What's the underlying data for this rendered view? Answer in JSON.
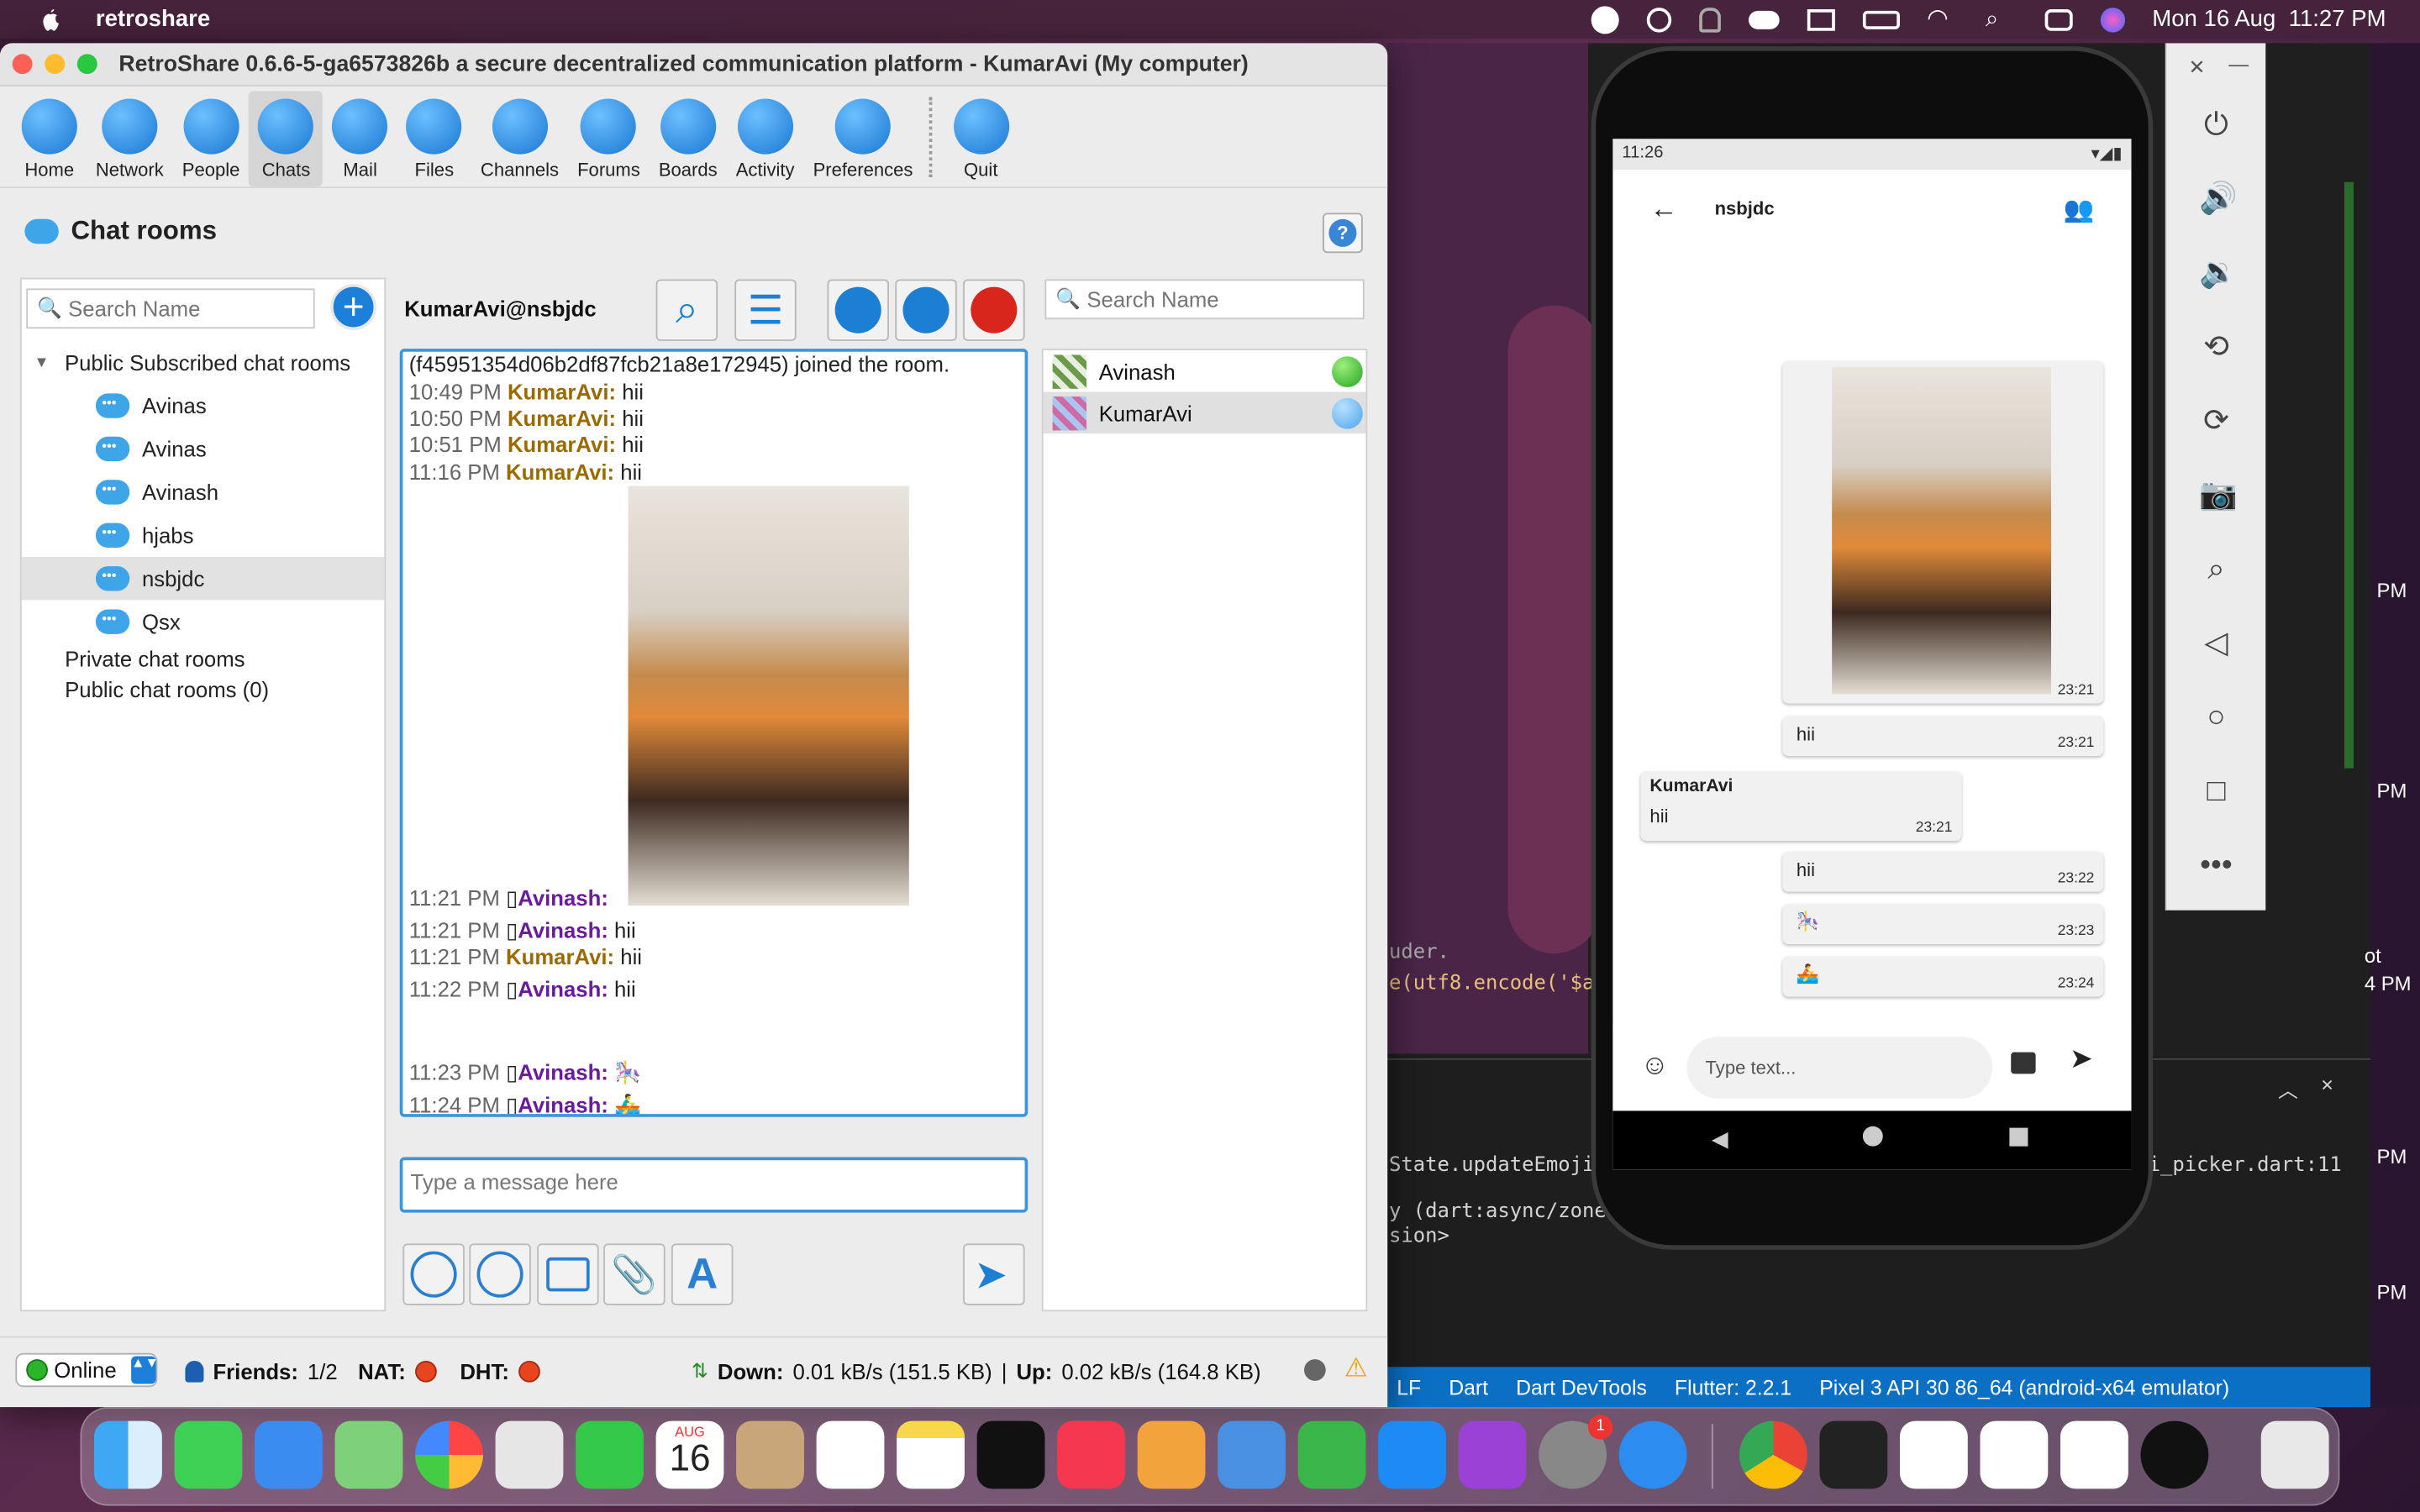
{
  "menubar": {
    "app_name": "retroshare",
    "datetime": "Mon 16 Aug  11:27 PM"
  },
  "window": {
    "title": "RetroShare 0.6.6-5-ga6573826b a secure decentralized communication platform - KumarAvi (My computer)"
  },
  "toolbar": {
    "items": [
      {
        "label": "Home",
        "icon": "home-icon"
      },
      {
        "label": "Network",
        "icon": "network-icon"
      },
      {
        "label": "People",
        "icon": "people-icon"
      },
      {
        "label": "Chats",
        "icon": "chat-icon"
      },
      {
        "label": "Mail",
        "icon": "mail-icon"
      },
      {
        "label": "Files",
        "icon": "files-icon"
      },
      {
        "label": "Channels",
        "icon": "channels-icon"
      },
      {
        "label": "Forums",
        "icon": "forums-icon"
      },
      {
        "label": "Boards",
        "icon": "boards-icon"
      },
      {
        "label": "Activity",
        "icon": "activity-icon"
      },
      {
        "label": "Preferences",
        "icon": "gear-icon"
      },
      {
        "label": "Quit",
        "icon": "power-icon"
      }
    ],
    "active": "Chats"
  },
  "chatrooms": {
    "title": "Chat rooms",
    "search_placeholder": "Search Name",
    "tree": {
      "public_subscribed": "Public Subscribed chat rooms",
      "rooms": [
        "Avinas",
        "Avinas",
        "Avinash",
        "hjabs",
        "nsbjdc",
        "Qsx"
      ],
      "selected_room": "nsbjdc",
      "private": "Private chat rooms",
      "public": "Public chat rooms (0)"
    }
  },
  "chat": {
    "header": "KumarAvi@nsbjdc",
    "joined": "(f45951354d06b2df87fcb21a8e172945) joined the room.",
    "messages": [
      {
        "time": "10:49 PM",
        "nick": "KumarAvi:",
        "text": "hii"
      },
      {
        "time": "10:50 PM",
        "nick": "KumarAvi:",
        "text": "hii"
      },
      {
        "time": "10:51 PM",
        "nick": "KumarAvi:",
        "text": "hii"
      },
      {
        "time": "11:16 PM",
        "nick": "KumarAvi:",
        "text": "hii"
      },
      {
        "time": "11:21 PM",
        "nick": "Avinash:",
        "text": ""
      },
      {
        "time": "11:21 PM",
        "nick": "Avinash:",
        "text": "hii"
      },
      {
        "time": "11:21 PM",
        "nick": "KumarAvi:",
        "text": "hii"
      },
      {
        "time": "11:22 PM",
        "nick": "Avinash:",
        "text": "hii"
      },
      {
        "time": "11:23 PM",
        "nick": "Avinash:",
        "text": "🎠"
      },
      {
        "time": "11:24 PM",
        "nick": "Avinash:",
        "text": "🚣‍♂"
      }
    ],
    "composer_placeholder": "Type a message here",
    "member_search_placeholder": "Search Name",
    "members": [
      "Avinash",
      "KumarAvi"
    ]
  },
  "statusbar": {
    "status": "Online",
    "friends_label": "Friends:",
    "friends_value": "1/2",
    "nat": "NAT:",
    "dht": "DHT:",
    "down_label": "Down:",
    "down_value": "0.01 kB/s (151.5 KB)",
    "sep": "|",
    "up_label": "Up:",
    "up_value": "0.02 kB/s (164.8 KB)"
  },
  "ide": {
    "code1": "e(utf8.encode('$a",
    "code0": "uder.",
    "term1": "State.updateEmojis",
    "term2": "y (dart:async/zone",
    "term3": "sion>",
    "term_right": "i_picker.dart:11",
    "status": [
      "LF",
      "Dart",
      "Dart DevTools",
      "Flutter: 2.2.1",
      "Pixel 3 API 30 86_64 (android-x64 emulator)"
    ],
    "side_times": [
      "PM",
      "PM",
      "ot",
      "4 PM",
      "PM",
      "PM"
    ]
  },
  "phone": {
    "time": "11:26",
    "room": "nsbjdc",
    "bubbles": [
      {
        "sender": "",
        "text": "",
        "time": "23:21"
      },
      {
        "sender": "",
        "text": "hii",
        "time": "23:21"
      },
      {
        "sender": "KumarAvi",
        "text": "hii",
        "time": "23:21"
      },
      {
        "sender": "",
        "text": "hii",
        "time": "23:22"
      },
      {
        "sender": "",
        "text": "🎠",
        "time": "23:23"
      },
      {
        "sender": "",
        "text": "🚣",
        "time": "23:24"
      }
    ],
    "input_placeholder": "Type text..."
  },
  "dock": {
    "calendar_month": "AUG",
    "calendar_day": "16",
    "badge": "1"
  },
  "colors": {
    "accent": "#1c7fd9",
    "nick_self": "#9b6a00",
    "nick_other": "#6a1a9e",
    "ide_status": "#0b6fc4"
  }
}
